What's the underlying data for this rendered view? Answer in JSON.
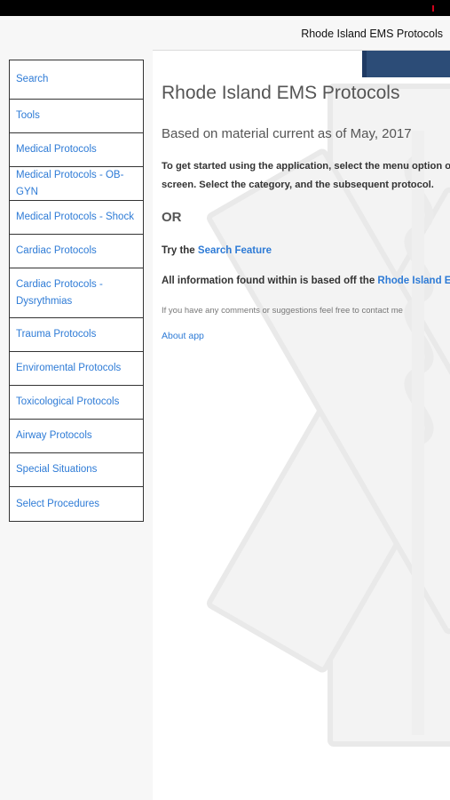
{
  "nav": {
    "title": "Rhode Island EMS Protocols"
  },
  "menu": {
    "items": [
      {
        "label": "Search",
        "name": "menu-search"
      },
      {
        "label": "Tools",
        "name": "menu-tools"
      },
      {
        "label": "Medical Protocols",
        "name": "menu-medical-protocols"
      },
      {
        "label": "Medical Protocols - OB-GYN",
        "name": "menu-medical-protocols-ob-gyn"
      },
      {
        "label": "Medical Protocols - Shock",
        "name": "menu-medical-protocols-shock"
      },
      {
        "label": "Cardiac Protocols",
        "name": "menu-cardiac-protocols"
      },
      {
        "label": "Cardiac Protocols - Dysrythmias",
        "name": "menu-cardiac-protocols-dysrythmias"
      },
      {
        "label": "Trauma Protocols",
        "name": "menu-trauma-protocols"
      },
      {
        "label": "Enviromental Protocols",
        "name": "menu-enviromental-protocols"
      },
      {
        "label": "Toxicological Protocols",
        "name": "menu-toxicological-protocols"
      },
      {
        "label": "Airway Protocols",
        "name": "menu-airway-protocols"
      },
      {
        "label": "Special Situations",
        "name": "menu-special-situations"
      },
      {
        "label": "Select Procedures",
        "name": "menu-select-procedures"
      }
    ]
  },
  "content": {
    "title": "Rhode Island EMS Protocols",
    "subtitle": "Based on material current as of May, 2017",
    "intro_line1": "To get started using the application, select the menu option on t",
    "intro_line2": "screen. Select the category, and the subsequent protocol.",
    "or": "OR",
    "try_prefix": "Try the ",
    "search_feature_link": "Search Feature",
    "info_prefix": "All information found within is based off the ",
    "info_link": "Rhode Island EMS P",
    "comments": "If you have any comments or suggestions feel free to contact me",
    "about_link": "About app"
  },
  "colors": {
    "link": "#2e7bd6",
    "header_bar": "#2c4c77",
    "statusbar": "#000000"
  },
  "icons": {
    "background": "star-of-life-icon"
  }
}
